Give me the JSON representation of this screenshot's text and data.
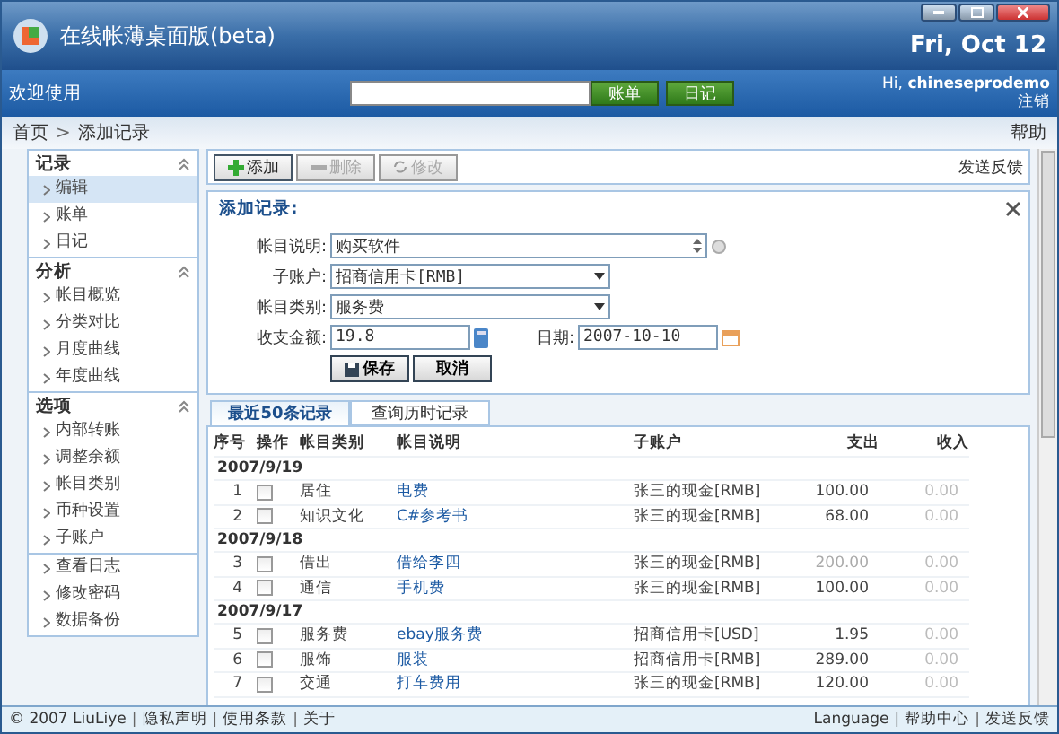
{
  "window": {
    "title": "在线帐薄桌面版(beta)",
    "date": "Fri, Oct 12"
  },
  "navbar": {
    "welcome": "欢迎使用",
    "search_buttons": [
      "账单",
      "日记"
    ],
    "greeting": "Hi, **chineseprodemo**",
    "logout": "注销"
  },
  "breadcrumb": {
    "items": [
      "首页",
      "添加记录"
    ],
    "separator": ">",
    "help": "帮助"
  },
  "sidebar": {
    "sections": [
      {
        "title": "记录",
        "expanded": true,
        "items": [
          {
            "label": "编辑",
            "selected": true
          },
          {
            "label": "账单",
            "selected": false
          },
          {
            "label": "日记",
            "selected": false
          }
        ]
      },
      {
        "title": "分析",
        "expanded": true,
        "items": [
          {
            "label": "帐目概览",
            "selected": false
          },
          {
            "label": "分类对比",
            "selected": false
          },
          {
            "label": "月度曲线",
            "selected": false
          },
          {
            "label": "年度曲线",
            "selected": false
          }
        ]
      },
      {
        "title": "选项",
        "expanded": true,
        "items": [
          {
            "label": "内部转账",
            "selected": false
          },
          {
            "label": "调整余额",
            "selected": false
          },
          {
            "label": "帐目类别",
            "selected": false
          },
          {
            "label": "币种设置",
            "selected": false
          },
          {
            "label": "子账户",
            "selected": false
          }
        ]
      },
      {
        "items": [
          {
            "label": "查看日志",
            "selected": false
          },
          {
            "label": "修改密码",
            "selected": false
          },
          {
            "label": "数据备份",
            "selected": false
          }
        ]
      }
    ]
  },
  "toolbar": {
    "buttons": [
      {
        "kind": "add",
        "label": "添加",
        "disabled": false
      },
      {
        "kind": "delete",
        "label": "删除",
        "disabled": true
      },
      {
        "kind": "edit",
        "label": "修改",
        "disabled": true
      }
    ],
    "feedback": "发送反馈"
  },
  "form": {
    "title": "添加记录:",
    "description": {
      "label": "帐目说明:",
      "value": "购买软件"
    },
    "subaccount": {
      "label": "子账户:",
      "value": "招商信用卡[RMB]"
    },
    "category": {
      "label": "帐目类别:",
      "value": "服务费"
    },
    "amount": {
      "label": "收支金额:",
      "value": "19.8"
    },
    "date": {
      "label": "日期:",
      "value": "2007-10-10"
    },
    "buttons": [
      "保存",
      "取消"
    ]
  },
  "tabs": [
    {
      "label": "最近50条记录",
      "selected": true
    },
    {
      "label": "查询历时记录",
      "selected": false
    }
  ],
  "table": {
    "columns": [
      "序号",
      "操作",
      "帐目类别",
      "帐目说明",
      "子账户",
      "支出",
      "收入"
    ],
    "groups": [
      {
        "date": "2007/9/19",
        "rows": [
          {
            "no": "1",
            "checked": false,
            "category": "居住",
            "description": "电费",
            "account": "张三的现金[RMB]",
            "expense": "100.00",
            "expense_dimmed": false,
            "income": "0.00"
          },
          {
            "no": "2",
            "checked": false,
            "category": "知识文化",
            "description": "C#参考书",
            "account": "张三的现金[RMB]",
            "expense": "68.00",
            "expense_dimmed": false,
            "income": "0.00"
          }
        ]
      },
      {
        "date": "2007/9/18",
        "rows": [
          {
            "no": "3",
            "checked": false,
            "category": "借出",
            "description": "借给李四",
            "account": "张三的现金[RMB]",
            "expense": "200.00",
            "expense_dimmed": true,
            "income": "0.00"
          },
          {
            "no": "4",
            "checked": false,
            "category": "通信",
            "description": "手机费",
            "account": "张三的现金[RMB]",
            "expense": "100.00",
            "expense_dimmed": false,
            "income": "0.00"
          }
        ]
      },
      {
        "date": "2007/9/17",
        "rows": [
          {
            "no": "5",
            "checked": false,
            "category": "服务费",
            "description": "ebay服务费",
            "account": "招商信用卡[USD]",
            "expense": "1.95",
            "expense_dimmed": false,
            "income": "0.00"
          },
          {
            "no": "6",
            "checked": false,
            "category": "服饰",
            "description": "服装",
            "account": "招商信用卡[RMB]",
            "expense": "289.00",
            "expense_dimmed": false,
            "income": "0.00"
          },
          {
            "no": "7",
            "checked": false,
            "category": "交通",
            "description": "打车费用",
            "account": "张三的现金[RMB]",
            "expense": "120.00",
            "expense_dimmed": false,
            "income": "0.00"
          }
        ]
      }
    ]
  },
  "footer": {
    "separator": "|",
    "left": [
      "© 2007 LiuLiye",
      "隐私声明",
      "使用条款",
      "关于"
    ],
    "right": [
      "Language",
      "帮助中心",
      "发送反馈"
    ]
  }
}
